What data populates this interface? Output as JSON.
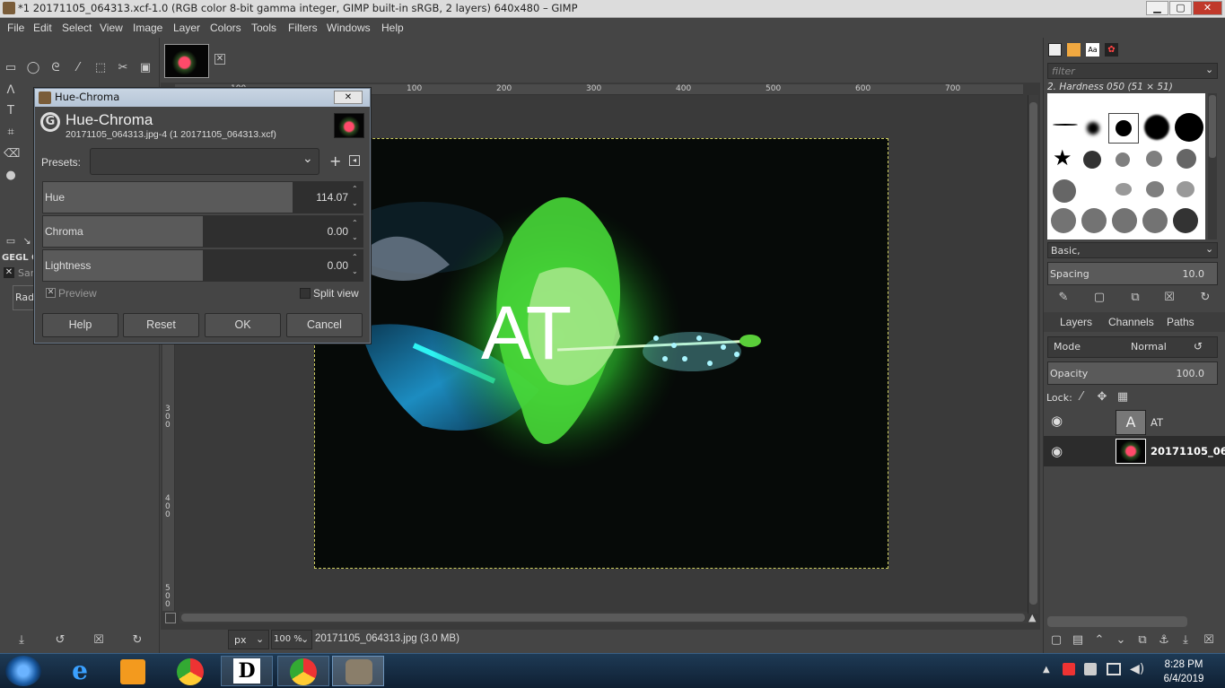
{
  "window": {
    "title": "*1 20171105_064313.xcf-1.0 (RGB color 8-bit gamma integer, GIMP built-in sRGB, 2 layers) 640x480 – GIMP",
    "minimize": "▁",
    "maximize": "▢",
    "close": "✕"
  },
  "menu": [
    "File",
    "Edit",
    "Select",
    "View",
    "Image",
    "Layer",
    "Colors",
    "Tools",
    "Filters",
    "Windows",
    "Help"
  ],
  "toolbox": {
    "gegl_label": "GEGL O",
    "sample_label": "Sar",
    "radius_label": "Radi"
  },
  "rulers": {
    "h": [
      "100",
      "100",
      "200",
      "300",
      "400",
      "500",
      "600",
      "700"
    ],
    "v": [
      "3\n0\n0",
      "4\n0\n0",
      "5\n0\n0"
    ]
  },
  "canvas": {
    "overlay_text": "AT"
  },
  "dialog": {
    "window_title": "Hue-Chroma",
    "heading": "Hue-Chroma",
    "subtitle": "20171105_064313.jpg-4 (1 20171105_064313.xcf)",
    "presets_label": "Presets:",
    "presets_value": "",
    "sliders": [
      {
        "label": "Hue",
        "value": "114.07",
        "fill": 0.78
      },
      {
        "label": "Chroma",
        "value": "0.00",
        "fill": 0.5
      },
      {
        "label": "Lightness",
        "value": "0.00",
        "fill": 0.5
      }
    ],
    "preview_label": "Preview",
    "split_view_label": "Split view",
    "buttons": {
      "help": "Help",
      "reset": "Reset",
      "ok": "OK",
      "cancel": "Cancel"
    }
  },
  "status": {
    "unit": "px",
    "zoom": "100 %",
    "file_info": "20171105_064313.jpg (3.0 MB)"
  },
  "brushes": {
    "filter_placeholder": "filter",
    "current": "2. Hardness 050 (51 × 51)",
    "tag": "Basic,",
    "spacing_label": "Spacing",
    "spacing_value": "10.0"
  },
  "layers_panel": {
    "tabs": [
      "Layers",
      "Channels",
      "Paths"
    ],
    "mode_label": "Mode",
    "mode_value": "Normal",
    "opacity_label": "Opacity",
    "opacity_value": "100.0",
    "lock_label": "Lock:",
    "layers": [
      {
        "name": "AT",
        "kind": "text"
      },
      {
        "name": "20171105_06",
        "kind": "image"
      }
    ]
  },
  "taskbar": {
    "time": "8:28 PM",
    "date": "6/4/2019",
    "apps": [
      "start",
      "ie",
      "media-player",
      "chrome",
      "d-app",
      "chrome",
      "gimp"
    ]
  },
  "colors": {
    "bg": "#454545",
    "glow": "#36e83a",
    "leaf_cyan": "#1fa8c9",
    "taskbar": "#17304a"
  }
}
